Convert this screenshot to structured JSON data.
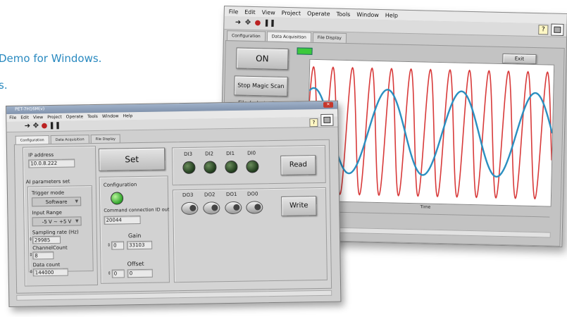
{
  "caption": {
    "line1": "Demo for Windows.",
    "line2": "s."
  },
  "back_window": {
    "menu": [
      "File",
      "Edit",
      "View",
      "Project",
      "Operate",
      "Tools",
      "Window",
      "Help"
    ],
    "tabs": [
      "Configuration",
      "Data Acquisition",
      "File Display"
    ],
    "on_button": "ON",
    "stop_button": "Stop Magic Scan",
    "file_label": "File (n bytes)",
    "exit_button": "Exit",
    "x_axis_label": "Time",
    "colors": {
      "sine_fast": "#d83a3a",
      "sine_slow": "#2b8fc0"
    }
  },
  "front_window": {
    "title": "PET-7H16M(v)",
    "menu": [
      "File",
      "Edit",
      "View",
      "Project",
      "Operate",
      "Tools",
      "Window",
      "Help"
    ],
    "tabs": [
      "Configuration",
      "Data Acquisition",
      "File Display"
    ],
    "ip_label": "IP address",
    "ip_value": "10.0.8.222",
    "ai_params_label": "AI parameters set",
    "trigger_mode_label": "Trigger mode",
    "trigger_mode_value": "Software",
    "input_range_label": "Input Range",
    "input_range_value": "-5 V ~ +5 V",
    "sampling_rate_label": "Sampling rate (Hz)",
    "sampling_rate_value": "29985",
    "channel_count_label": "ChannelCount",
    "channel_count_value": "8",
    "data_count_label": "Data count",
    "data_count_value": "144000",
    "set_button": "Set",
    "configuration_label": "Configuration",
    "cmd_conn_label": "Command connection ID out",
    "cmd_conn_value": "20044",
    "gain_label": "Gain",
    "gain_index": "0",
    "gain_value": "33103",
    "offset_label": "Offset",
    "offset_index": "0",
    "offset_value": "0",
    "di_labels": [
      "DI3",
      "DI2",
      "DI1",
      "DI0"
    ],
    "read_button": "Read",
    "do_labels": [
      "DO3",
      "DO2",
      "DO1",
      "DO0"
    ],
    "write_button": "Write"
  }
}
